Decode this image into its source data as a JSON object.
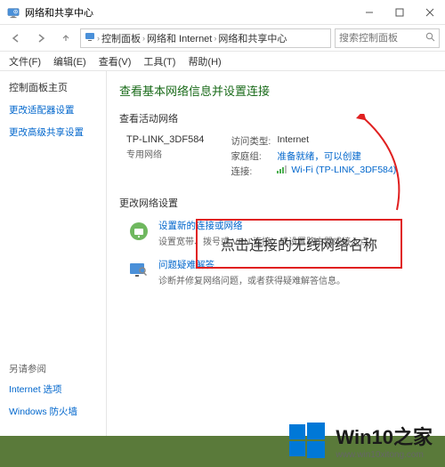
{
  "window": {
    "title": "网络和共享中心"
  },
  "breadcrumb": {
    "root_icon": "monitor",
    "items": [
      "控制面板",
      "网络和 Internet",
      "网络和共享中心"
    ]
  },
  "search": {
    "placeholder": "搜索控制面板"
  },
  "menu": {
    "items": [
      "文件(F)",
      "编辑(E)",
      "查看(V)",
      "工具(T)",
      "帮助(H)"
    ]
  },
  "sidebar": {
    "heading": "控制面板主页",
    "links": [
      "更改适配器设置",
      "更改高级共享设置"
    ],
    "see_also_label": "另请参阅",
    "see_also": [
      "Internet 选项",
      "Windows 防火墙"
    ]
  },
  "main": {
    "title": "查看基本网络信息并设置连接",
    "active_heading": "查看活动网络",
    "network": {
      "name": "TP-LINK_3DF584",
      "subtype": "专用网络",
      "access_label": "访问类型:",
      "access_value": "Internet",
      "homegroup_label": "家庭组:",
      "homegroup_value": "准备就绪，可以创建",
      "conn_label": "连接:",
      "conn_value": "Wi-Fi (TP-LINK_3DF584)"
    },
    "change_heading": "更改网络设置",
    "newconn": {
      "title": "设置新的连接或网络",
      "desc": "设置宽带、拨号或 VPN 连接；或设置路由器或接入点。"
    },
    "troubleshoot": {
      "title": "问题疑难解答",
      "desc": "诊断并修复网络问题，或者获得疑难解答信息。"
    }
  },
  "annotation": {
    "text": "点击连接的无线网络名称"
  },
  "watermark": {
    "title": "Win10之家",
    "url": "www.win10xitong.com"
  }
}
